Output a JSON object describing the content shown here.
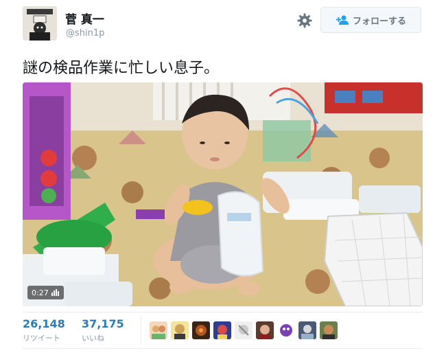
{
  "user": {
    "display_name": "菅 真一",
    "handle": "@shin1p"
  },
  "actions": {
    "follow_label": "フォローする",
    "gear_icon": "gear-icon",
    "follow_icon": "add-user-icon"
  },
  "tweet": {
    "text": "謎の検品作業に忙しい息子。"
  },
  "media": {
    "duration": "0:27"
  },
  "stats": {
    "retweets": "26,148",
    "retweets_label": "リツイート",
    "likes": "37,175",
    "likes_label": "いいね"
  },
  "colors": {
    "link": "#2b7bb9",
    "muted": "#8899a6",
    "text": "#14171a"
  }
}
